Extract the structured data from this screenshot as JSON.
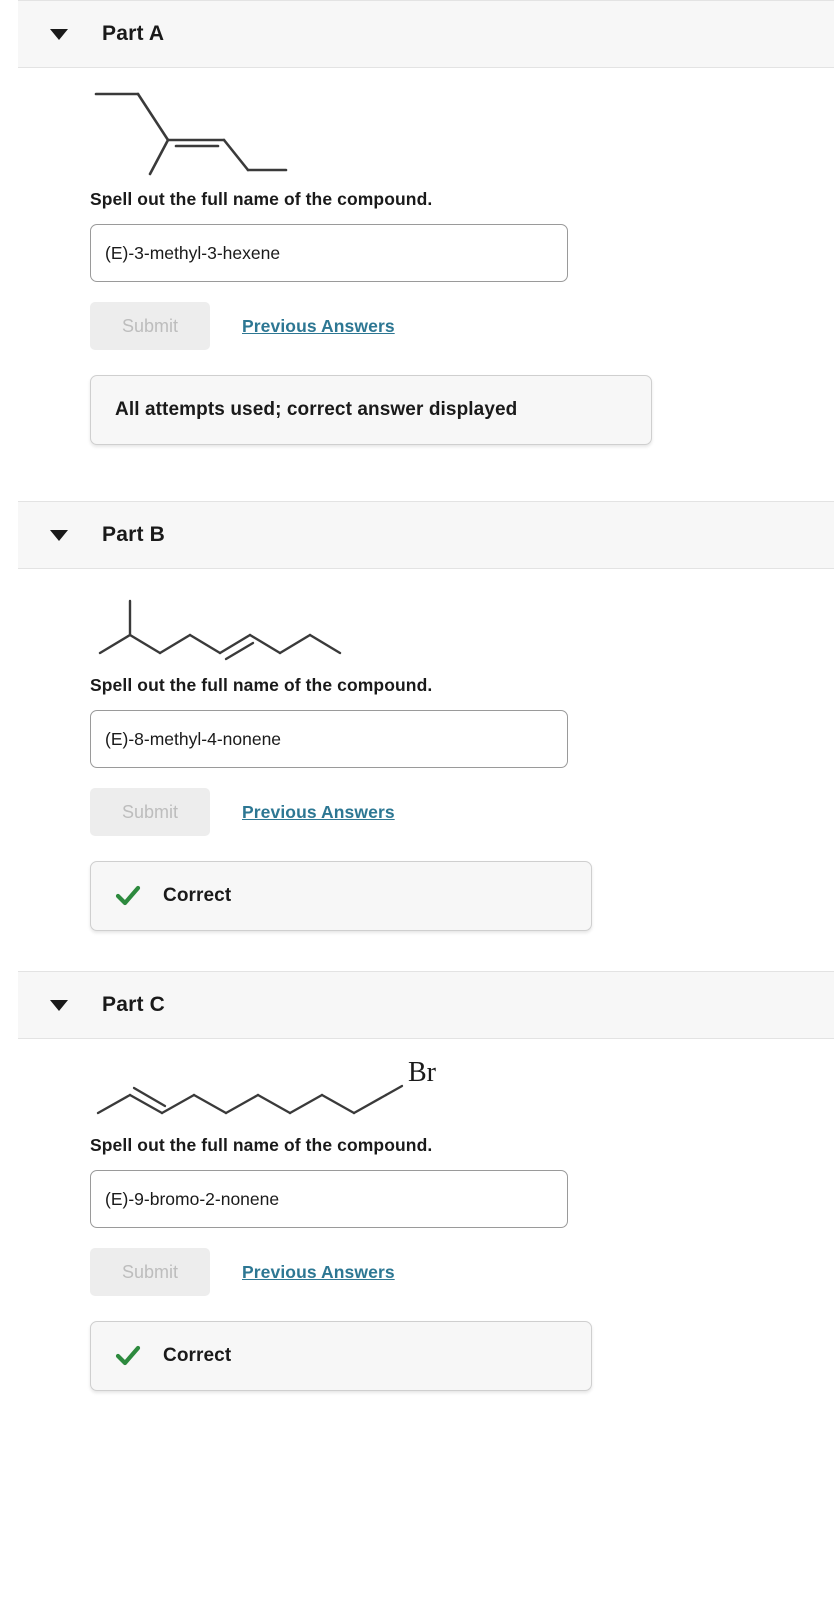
{
  "parts": [
    {
      "id": "part-a",
      "title": "Part A",
      "caret_icon": "caret-down-icon",
      "prompt": "Spell out the full name of the compound.",
      "answer_value": "(E)-3-methyl-3-hexene",
      "answer_placeholder": "",
      "submit_label": "Submit",
      "previous_answers_label": "Previous Answers",
      "feedback_text": "All attempts used; correct answer displayed",
      "feedback_type": "attempts-used",
      "molecule": {
        "name": "(E)-3-methyl-3-hexene",
        "label": "",
        "formula_hint": "C7H14"
      }
    },
    {
      "id": "part-b",
      "title": "Part B",
      "caret_icon": "caret-down-icon",
      "prompt": "Spell out the full name of the compound.",
      "answer_value": "(E)-8-methyl-4-nonene",
      "answer_placeholder": "",
      "submit_label": "Submit",
      "previous_answers_label": "Previous Answers",
      "feedback_text": "Correct",
      "feedback_type": "correct",
      "molecule": {
        "name": "(E)-8-methyl-4-nonene",
        "label": "",
        "formula_hint": "C10H20"
      }
    },
    {
      "id": "part-c",
      "title": "Part C",
      "caret_icon": "caret-down-icon",
      "prompt": "Spell out the full name of the compound.",
      "answer_value": "(E)-9-bromo-2-nonene",
      "answer_placeholder": "",
      "submit_label": "Submit",
      "previous_answers_label": "Previous Answers",
      "feedback_text": "Correct",
      "feedback_type": "correct",
      "molecule": {
        "name": "(E)-9-bromo-2-nonene",
        "label": "Br",
        "formula_hint": "C9H17Br"
      }
    }
  ],
  "colors": {
    "link": "#2d7793",
    "correct_green": "#2d8a3e",
    "header_bg": "#f7f7f7",
    "feedback_bg": "#f7f7f7",
    "bond": "#3a3a3a",
    "disabled_text": "#bdbdbd"
  }
}
